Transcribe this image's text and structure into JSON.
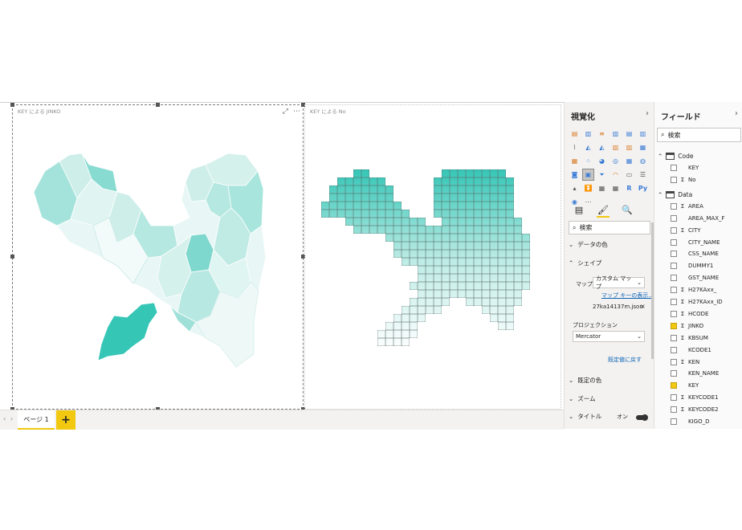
{
  "visuals": [
    {
      "title": "KEY による JINKO"
    },
    {
      "title": "KEY による No"
    }
  ],
  "page_tabs": {
    "page1": "ページ 1",
    "add": "+"
  },
  "viz_pane": {
    "title": "視覚化",
    "search_placeholder": "検索",
    "sections": {
      "data_colors": "データの色",
      "shape": "シェイプ",
      "map_label": "マップ",
      "map_value": "カスタム マップ",
      "map_keys_link": "マップ キーの表示...",
      "map_file": "27ka14137m.json",
      "projection_label": "プロジェクション",
      "projection_value": "Mercator",
      "reset_default": "既定値に戻す",
      "default_colors": "既定の色",
      "zoom": "ズーム",
      "title_label": "タイトル",
      "title_toggle": "オン"
    }
  },
  "fields_pane": {
    "title": "フィールド",
    "search_placeholder": "検索",
    "groups": [
      {
        "name": "Code",
        "fields": [
          {
            "name": "KEY",
            "sigma": false,
            "checked": false
          },
          {
            "name": "No",
            "sigma": true,
            "checked": false
          }
        ]
      },
      {
        "name": "Data",
        "fields": [
          {
            "name": "AREA",
            "sigma": true,
            "checked": false
          },
          {
            "name": "AREA_MAX_F",
            "sigma": false,
            "checked": false
          },
          {
            "name": "CITY",
            "sigma": true,
            "checked": false
          },
          {
            "name": "CITY_NAME",
            "sigma": false,
            "checked": false
          },
          {
            "name": "CSS_NAME",
            "sigma": false,
            "checked": false
          },
          {
            "name": "DUMMY1",
            "sigma": false,
            "checked": false
          },
          {
            "name": "GST_NAME",
            "sigma": false,
            "checked": false
          },
          {
            "name": "H27KAxx_",
            "sigma": true,
            "checked": false
          },
          {
            "name": "H27KAxx_ID",
            "sigma": true,
            "checked": false
          },
          {
            "name": "HCODE",
            "sigma": true,
            "checked": false
          },
          {
            "name": "JINKO",
            "sigma": true,
            "checked": true
          },
          {
            "name": "KBSUM",
            "sigma": true,
            "checked": false
          },
          {
            "name": "KCODE1",
            "sigma": false,
            "checked": false
          },
          {
            "name": "KEN",
            "sigma": true,
            "checked": false
          },
          {
            "name": "KEN_NAME",
            "sigma": false,
            "checked": false
          },
          {
            "name": "KEY",
            "sigma": false,
            "checked": true
          },
          {
            "name": "KEYCODE1",
            "sigma": true,
            "checked": false
          },
          {
            "name": "KEYCODE2",
            "sigma": true,
            "checked": false
          },
          {
            "name": "KIGO_D",
            "sigma": false,
            "checked": false
          }
        ]
      }
    ]
  },
  "colors": {
    "accent": "#f2c811",
    "map_base": "#e8f7f5",
    "map_dark": "#35c6b6"
  }
}
